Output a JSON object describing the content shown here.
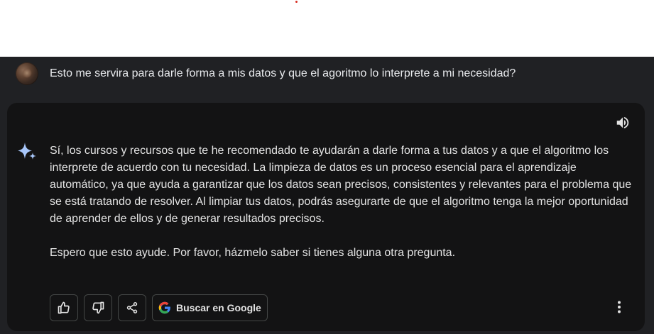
{
  "user_message": {
    "text": "Esto me servira para darle forma a mis datos y que el agoritmo lo interprete a mi necesidad?"
  },
  "response": {
    "paragraphs": [
      "Sí, los cursos y recursos que te he recomendado te ayudarán a darle forma a tus datos y a que el algoritmo los interprete de acuerdo con tu necesidad. La limpieza de datos es un proceso esencial para el aprendizaje automático, ya que ayuda a garantizar que los datos sean precisos, consistentes y relevantes para el problema que se está tratando de resolver. Al limpiar tus datos, podrás asegurarte de que el algoritmo tenga la mejor oportunidad de aprender de ellos y de generar resultados precisos.",
      "Espero que esto ayude. Por favor, házmelo saber si tienes alguna otra pregunta."
    ]
  },
  "actions": {
    "thumbs_up_icon": "thumbs-up-icon",
    "thumbs_down_icon": "thumbs-down-icon",
    "share_icon": "share-icon",
    "google_button_label": "Buscar en Google",
    "more_icon": "more-vert-icon",
    "speaker_icon": "volume-icon"
  },
  "colors": {
    "background": "#202124",
    "card": "#131314",
    "text": "#e3e3e3",
    "sparkle_accent": "#a8c7fa"
  }
}
